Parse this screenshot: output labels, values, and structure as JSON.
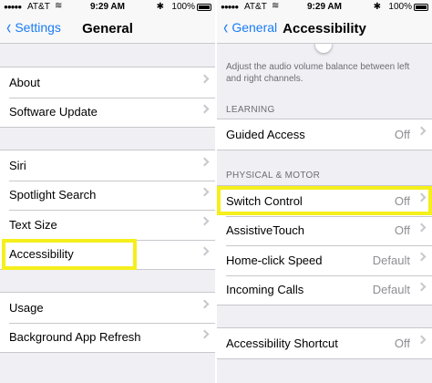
{
  "status": {
    "carrier": "AT&T",
    "time": "9:29 AM",
    "battery": "100%"
  },
  "left": {
    "nav": {
      "back": "Settings",
      "title": "General"
    },
    "group1": [
      {
        "label": "About"
      },
      {
        "label": "Software Update"
      }
    ],
    "group2": [
      {
        "label": "Siri"
      },
      {
        "label": "Spotlight Search"
      },
      {
        "label": "Text Size"
      },
      {
        "label": "Accessibility"
      }
    ],
    "group3": [
      {
        "label": "Usage"
      },
      {
        "label": "Background App Refresh"
      }
    ]
  },
  "right": {
    "nav": {
      "back": "General",
      "title": "Accessibility"
    },
    "balance_footer": "Adjust the audio volume balance between left and right channels.",
    "learning": {
      "header": "LEARNING",
      "items": [
        {
          "label": "Guided Access",
          "value": "Off"
        }
      ]
    },
    "physical": {
      "header": "PHYSICAL & MOTOR",
      "items": [
        {
          "label": "Switch Control",
          "value": "Off"
        },
        {
          "label": "AssistiveTouch",
          "value": "Off"
        },
        {
          "label": "Home-click Speed",
          "value": "Default"
        },
        {
          "label": "Incoming Calls",
          "value": "Default"
        }
      ]
    },
    "shortcut": {
      "items": [
        {
          "label": "Accessibility Shortcut",
          "value": "Off"
        }
      ]
    }
  },
  "colors": {
    "highlight": "#f5ef1c",
    "tint": "#1a7cf5"
  }
}
